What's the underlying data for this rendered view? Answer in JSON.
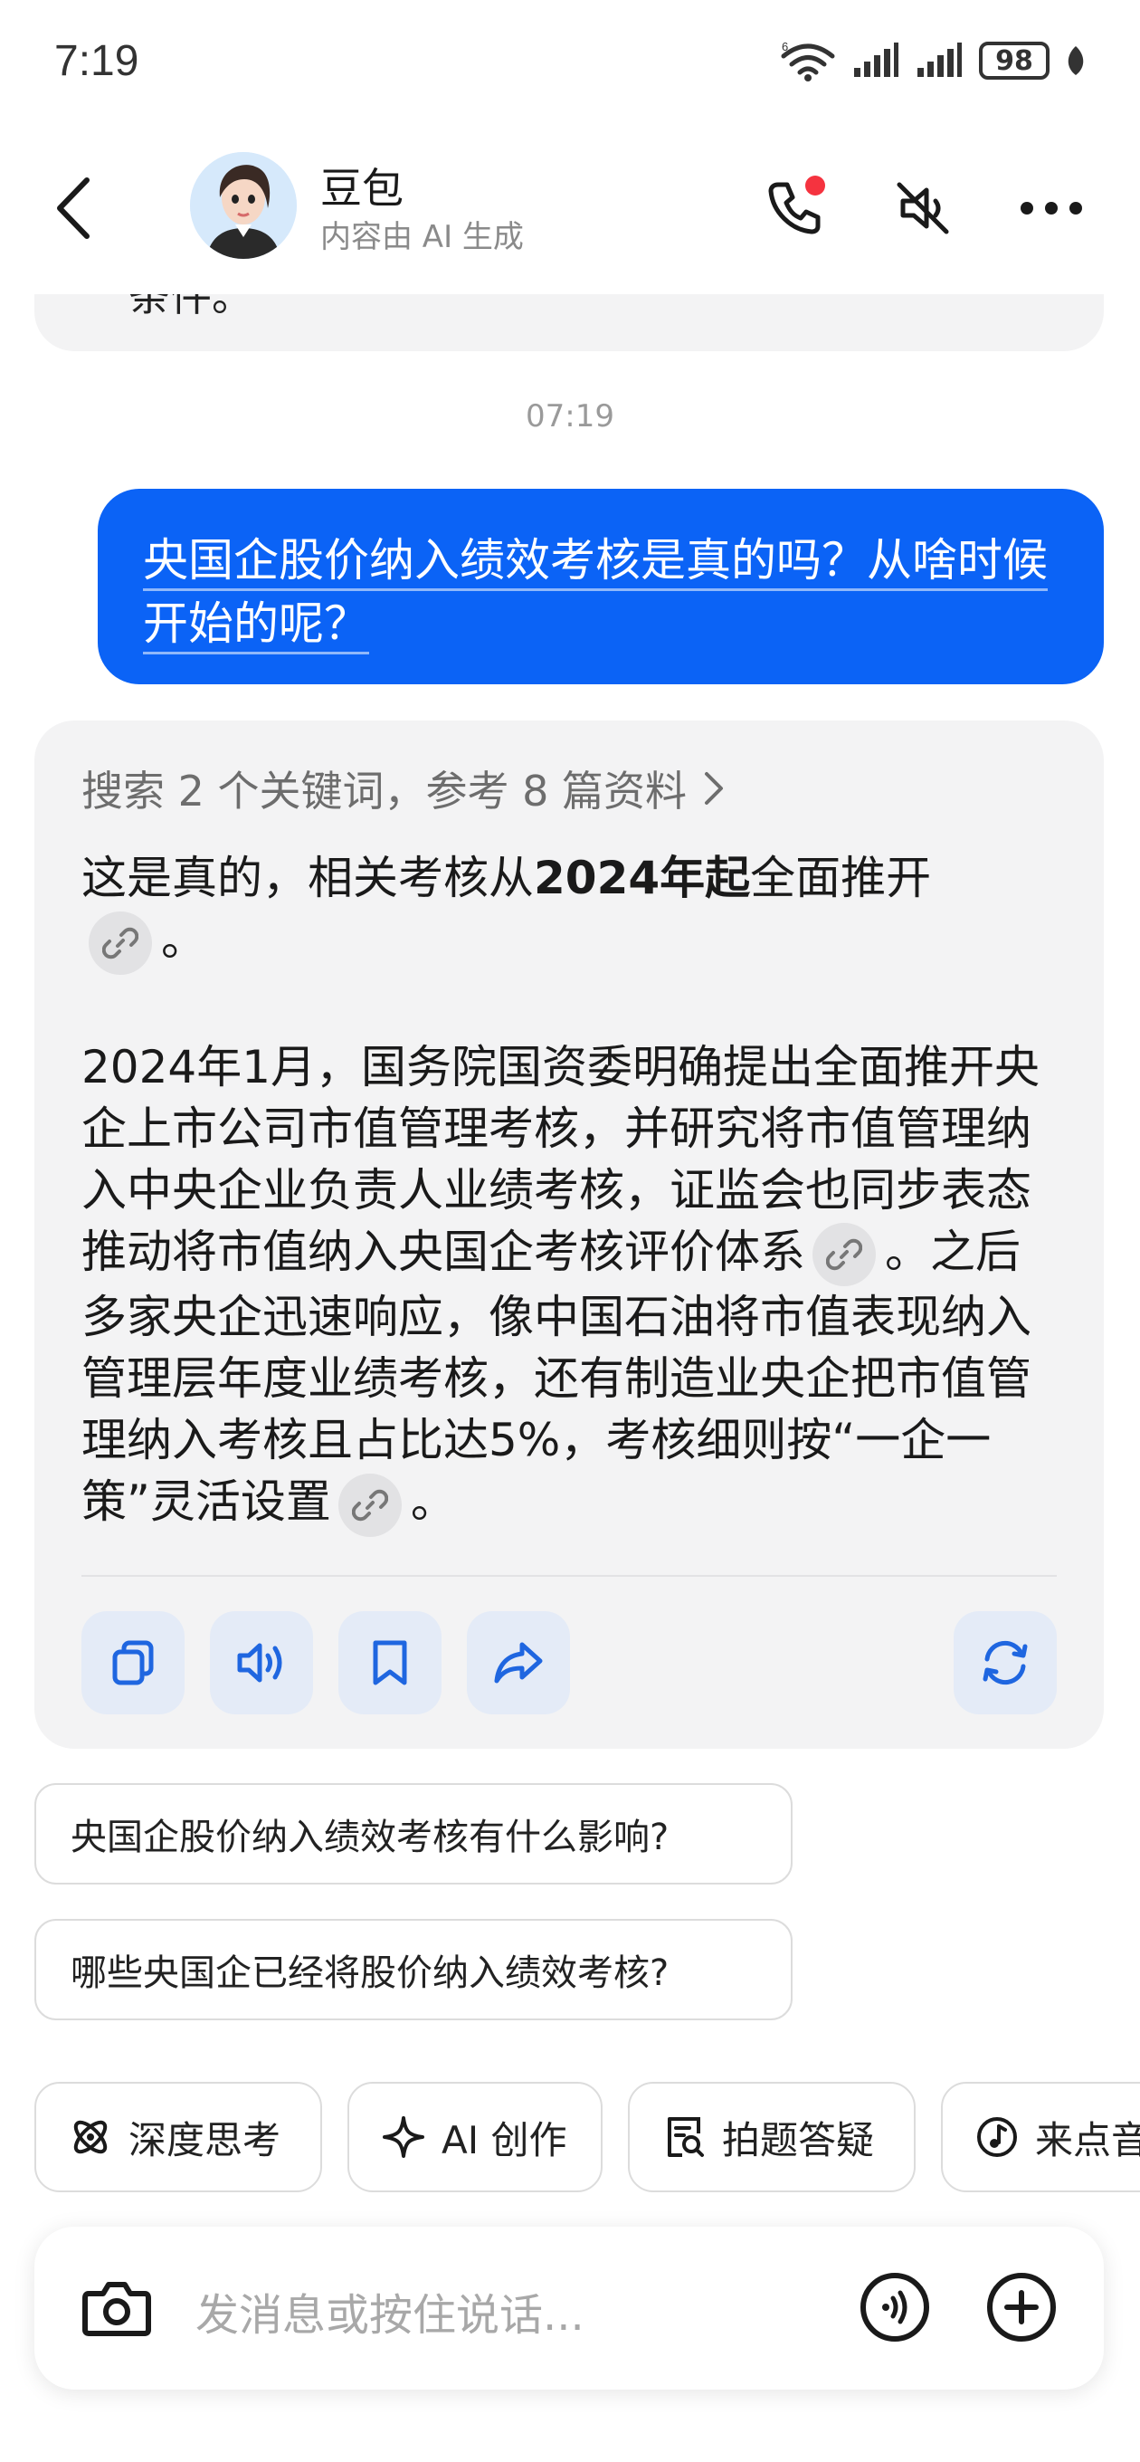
{
  "status_bar": {
    "time": "7:19",
    "battery": "98",
    "network": "6"
  },
  "header": {
    "name": "豆包",
    "subtitle": "内容由 AI 生成"
  },
  "previous_message": {
    "tail_text": "条件。"
  },
  "timestamp": "07:19",
  "user_message": {
    "text": "央国企股价纳入绩效考核是真的吗？从啥时候开始的呢？"
  },
  "bot_message": {
    "search_summary": "搜索 2 个关键词，参考 8 篇资料",
    "p1_before": "这是真的，相关考核从",
    "p1_bold": "2024年起",
    "p1_after": "全面推开",
    "p2_part1": "2024年1月，国务院国资委明确提出全面推开央企上市公司市值管理考核，并研究将市值管理纳入中央企业负责人业绩考核，证监会也同步表态推动将市值纳入央国企考核评价体系",
    "p2_part2": "。之后多家央企迅速响应，像中国石油将市值表现纳入管理层年度业绩考核，还有制造业央企把市值管理纳入考核且占比达5%，考核细则按“一企一策”灵活设置",
    "period": "。"
  },
  "suggestions": [
    "央国企股价纳入绩效考核有什么影响?",
    "哪些央国企已经将股价纳入绩效考核?"
  ],
  "tools": [
    {
      "label": "深度思考",
      "icon": "atom-icon"
    },
    {
      "label": "AI 创作",
      "icon": "sparkle-icon"
    },
    {
      "label": "拍题答疑",
      "icon": "scan-doc-icon"
    },
    {
      "label": "来点音",
      "icon": "music-note-icon"
    }
  ],
  "input": {
    "placeholder": "发消息或按住说话..."
  },
  "colors": {
    "accent": "#0b63f6",
    "bubble_gray": "#f3f3f4",
    "action_bg": "#e4ebf7",
    "notify_dot": "#f5333f"
  }
}
